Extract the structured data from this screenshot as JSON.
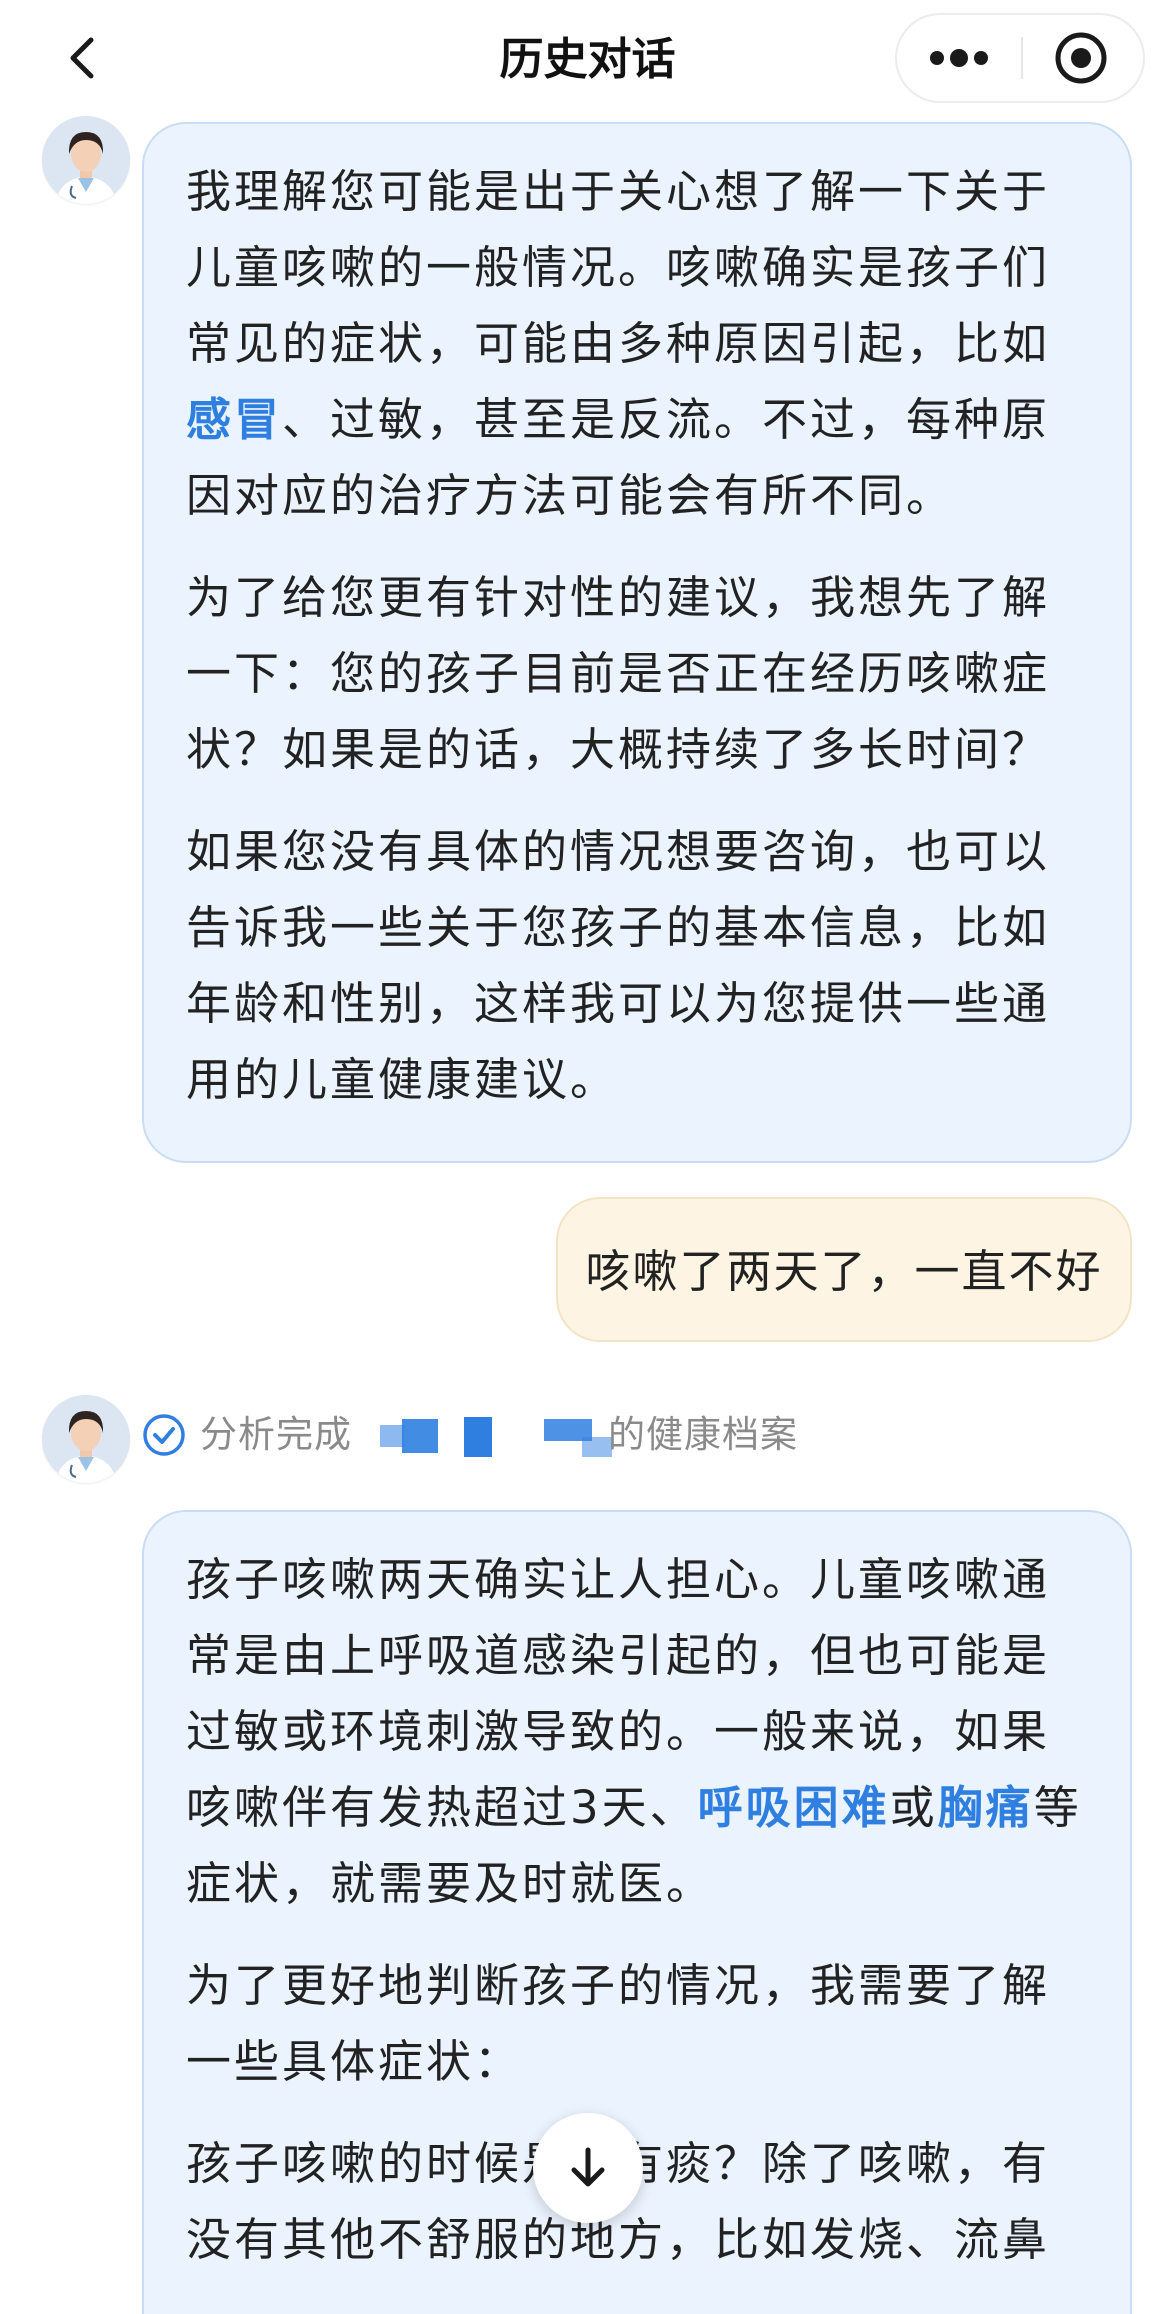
{
  "header": {
    "title": "历史对话",
    "back_icon": "chevron-left-icon",
    "more_icon": "more-dots-icon",
    "close_icon": "target-circle-icon"
  },
  "messages": {
    "bot_1": {
      "p1": {
        "a": "我理解您可能是出于关心想了解一下关于儿童咳嗽的一般情况。咳嗽确实是孩子们常见的症状，可能由多种原因引起，比如",
        "link": "感冒",
        "b": "、过敏，甚至是反流。不过，每种原因对应的治疗方法可能会有所不同。"
      },
      "p2": "为了给您更有针对性的建议，我想先了解一下：您的孩子目前是否正在经历咳嗽症状？如果是的话，大概持续了多长时间？",
      "p3": "如果您没有具体的情况想要咨询，也可以告诉我一些关于您孩子的基本信息，比如年龄和性别，这样我可以为您提供一些通用的儿童健康建议。"
    },
    "user_1": "咳嗽了两天了，一直不好",
    "status": {
      "prefix": "分析完成",
      "suffix": "的健康档案",
      "icon": "check-circle-icon"
    },
    "bot_2": {
      "p1": {
        "a": "孩子咳嗽两天确实让人担心。儿童咳嗽通常是由上呼吸道感染引起的，但也可能是过敏或环境刺激导致的。一般来说，如果咳嗽伴有发热超过3天、",
        "link1": "呼吸困难",
        "mid": "或",
        "link2": "胸痛",
        "b": "等症状，就需要及时就医。"
      },
      "p2": "为了更好地判断孩子的情况，我需要了解一些具体症状：",
      "p3": "孩子咳嗽的时候是否有痰？除了咳嗽，有没有其他不舒服的地方，比如发烧、流鼻"
    }
  },
  "scroll_icon": "arrow-down-icon",
  "colors": {
    "bot_bubble_bg": "#ebf3fe",
    "user_bubble_bg": "#fdf4e4",
    "link": "#2f7fe0",
    "status_text": "#8a8a8a"
  }
}
